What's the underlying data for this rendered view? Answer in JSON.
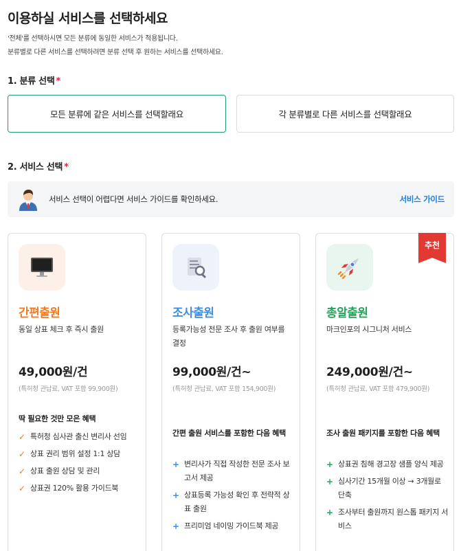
{
  "page": {
    "title": "이용하실 서비스를 선택하세요",
    "desc1": "'전체'를 선택하시면 모든 분류에 동일한 서비스가 적용됩니다.",
    "desc2": "분류별로 다른 서비스를 선택하려면 분류 선택 후 원하는 서비스를 선택하세요."
  },
  "step1": {
    "label": "1. 분류 선택",
    "required": "*",
    "options": [
      "모든 분류에 같은 서비스를 선택할래요",
      "각 분류별로 다른 서비스를 선택할래요"
    ]
  },
  "step2": {
    "label": "2. 서비스 선택",
    "required": "*"
  },
  "guide": {
    "text": "서비스 선택이 어렵다면 서비스 가이드를 확인하세요.",
    "link": "서비스 가이드"
  },
  "accent_colors": {
    "selected_border": "#1e9b6c",
    "required": "#e0243a",
    "link": "#1b7fe0",
    "card1": "#f07a22",
    "card2": "#3f8de0",
    "card3": "#26a35a",
    "badge": "#e23a32"
  },
  "cards": [
    {
      "icon": "monitor-icon",
      "name": "간편출원",
      "desc": "동일 상표 체크 후 즉시 출원",
      "price": "49,000원/건",
      "note": "(특허청 관납료, VAT 포함 99,900원)",
      "benefit_title": "딱 필요한 것만 모은 혜택",
      "marker": "✓",
      "benefits": [
        "특허청 심사관 출신 변리사 선임",
        "상표 권리 범위 설정 1:1 상담",
        "상표 출원 상담 및 관리",
        "상표권 120% 활용 가이드북"
      ]
    },
    {
      "icon": "document-search-icon",
      "name": "조사출원",
      "desc": "등록가능성 전문 조사 후 출원 여부를 결정",
      "price": "99,000원/건~",
      "note": "(특허청 관납료, VAT 포함 154,900원)",
      "benefit_title": "간편 출원 서비스를 포함한 다음 혜택",
      "marker": "+",
      "benefits": [
        "변리사가 직접 작성한 전문 조사 보고서 제공",
        "상표등록 가능성 확인 후 전략적 상표 출원",
        "프리미엄 네이밍 가이드북 제공"
      ]
    },
    {
      "icon": "rocket-icon",
      "badge": "추천",
      "name": "총알출원",
      "desc": "마크인포의 시그니처 서비스",
      "price": "249,000원/건~",
      "note": "(특허청 관납료, VAT 포함 479,900원)",
      "benefit_title": "조사 출원 패키지를 포함한 다음 혜택",
      "marker": "+",
      "benefits": [
        "상표권 침해 경고장 샘플 양식 제공",
        "심사기간 15개월 이상 → 3개월로 단축",
        "조사부터 출원까지 원스톱 패키지 서비스"
      ]
    }
  ]
}
